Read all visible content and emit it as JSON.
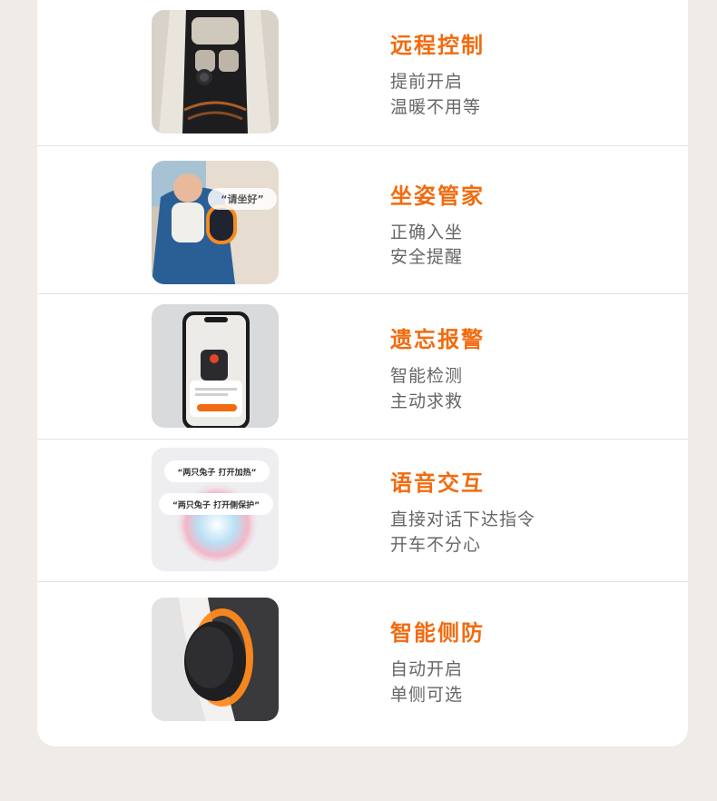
{
  "colors": {
    "accent": "#f26b0f",
    "body_text": "#666666",
    "divider": "#e6e2dd",
    "card_bg": "#ffffff",
    "page_bg": "#efebe6"
  },
  "features": [
    {
      "title": "远程控制",
      "lines": [
        "提前开启",
        "温暖不用等"
      ],
      "image": "car-interior-top-view"
    },
    {
      "title": "坐姿管家",
      "lines": [
        "正确入坐",
        "安全提醒"
      ],
      "image": "child-in-car-seat",
      "image_bubble": "“请坐好”"
    },
    {
      "title": "遗忘报警",
      "lines": [
        "智能检测",
        "主动求救"
      ],
      "image": "phone-app-alert"
    },
    {
      "title": "语音交互",
      "lines": [
        "直接对话下达指令",
        "开车不分心"
      ],
      "image": "voice-assistant-orb",
      "image_bubbles": [
        "“两只兔子 打开加热”",
        "“两只兔子 打开侧保护”"
      ]
    },
    {
      "title": "智能侧防",
      "lines": [
        "自动开启",
        "单侧可选"
      ],
      "image": "side-protection-pod"
    }
  ]
}
